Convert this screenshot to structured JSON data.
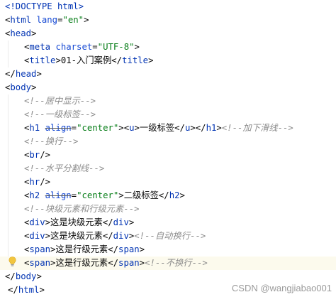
{
  "lines": [
    {
      "indent": 0,
      "tokens": [
        [
          "doctype",
          "<!DOCTYPE html>"
        ]
      ]
    },
    {
      "indent": 0,
      "tokens": [
        [
          "br",
          "<"
        ],
        [
          "tag",
          "html"
        ],
        [
          "txt",
          " "
        ],
        [
          "attr",
          "lang"
        ],
        [
          "br",
          "="
        ],
        [
          "str",
          "\"en\""
        ],
        [
          "br",
          ">"
        ]
      ]
    },
    {
      "indent": 0,
      "tokens": [
        [
          "br",
          "<"
        ],
        [
          "tag",
          "head"
        ],
        [
          "br",
          ">"
        ]
      ]
    },
    {
      "indent": 2,
      "tokens": [
        [
          "br",
          "<"
        ],
        [
          "tag",
          "meta"
        ],
        [
          "txt",
          " "
        ],
        [
          "attr",
          "charset"
        ],
        [
          "br",
          "="
        ],
        [
          "str",
          "\"UTF-8\""
        ],
        [
          "br",
          ">"
        ]
      ]
    },
    {
      "indent": 2,
      "tokens": [
        [
          "br",
          "<"
        ],
        [
          "tag",
          "title"
        ],
        [
          "br",
          ">"
        ],
        [
          "txt",
          "01-入门案例"
        ],
        [
          "br",
          "</"
        ],
        [
          "tag",
          "title"
        ],
        [
          "br",
          ">"
        ]
      ]
    },
    {
      "indent": 0,
      "tokens": [
        [
          "br",
          "</"
        ],
        [
          "tag",
          "head"
        ],
        [
          "br",
          ">"
        ]
      ]
    },
    {
      "indent": 0,
      "tokens": [
        [
          "br",
          "<"
        ],
        [
          "tag",
          "body"
        ],
        [
          "br",
          ">"
        ]
      ]
    },
    {
      "indent": 2,
      "tokens": [
        [
          "cmt",
          "<!--居中显示-->"
        ]
      ]
    },
    {
      "indent": 2,
      "tokens": [
        [
          "cmt",
          "<!--一级标签-->"
        ]
      ]
    },
    {
      "indent": 2,
      "tokens": [
        [
          "br",
          "<"
        ],
        [
          "tag",
          "h1"
        ],
        [
          "txt",
          " "
        ],
        [
          "dep",
          "align"
        ],
        [
          "br",
          "="
        ],
        [
          "str",
          "\"center\""
        ],
        [
          "br",
          ">"
        ],
        [
          "br",
          "<"
        ],
        [
          "tag",
          "u"
        ],
        [
          "br",
          ">"
        ],
        [
          "txt",
          "一级标签"
        ],
        [
          "br",
          "</"
        ],
        [
          "tag",
          "u"
        ],
        [
          "br",
          "></"
        ],
        [
          "tag",
          "h1"
        ],
        [
          "br",
          ">"
        ],
        [
          "cmt",
          "<!--加下滑线-->"
        ]
      ]
    },
    {
      "indent": 2,
      "tokens": [
        [
          "cmt",
          "<!--换行-->"
        ]
      ]
    },
    {
      "indent": 2,
      "tokens": [
        [
          "br",
          "<"
        ],
        [
          "tag",
          "br"
        ],
        [
          "br",
          "/>"
        ]
      ]
    },
    {
      "indent": 2,
      "tokens": [
        [
          "cmt",
          "<!--水平分割线-->"
        ]
      ]
    },
    {
      "indent": 2,
      "tokens": [
        [
          "br",
          "<"
        ],
        [
          "tag",
          "hr"
        ],
        [
          "br",
          "/>"
        ]
      ]
    },
    {
      "indent": 2,
      "tokens": [
        [
          "br",
          "<"
        ],
        [
          "tag",
          "h2"
        ],
        [
          "txt",
          " "
        ],
        [
          "dep",
          "align"
        ],
        [
          "br",
          "="
        ],
        [
          "str",
          "\"center\""
        ],
        [
          "br",
          ">"
        ],
        [
          "txt",
          "二级标签"
        ],
        [
          "br",
          "</"
        ],
        [
          "tag",
          "h2"
        ],
        [
          "br",
          ">"
        ]
      ]
    },
    {
      "indent": 2,
      "tokens": [
        [
          "cmt",
          "<!--块级元素和行级元素-->"
        ]
      ]
    },
    {
      "indent": 2,
      "tokens": [
        [
          "br",
          "<"
        ],
        [
          "tag",
          "div"
        ],
        [
          "br",
          ">"
        ],
        [
          "txt",
          "这是块级元素"
        ],
        [
          "br",
          "</"
        ],
        [
          "tag",
          "div"
        ],
        [
          "br",
          ">"
        ]
      ]
    },
    {
      "indent": 2,
      "tokens": [
        [
          "br",
          "<"
        ],
        [
          "tag",
          "div"
        ],
        [
          "br",
          ">"
        ],
        [
          "txt",
          "这是块级元素"
        ],
        [
          "br",
          "</"
        ],
        [
          "tag",
          "div"
        ],
        [
          "br",
          ">"
        ],
        [
          "cmt",
          "<!--自动换行-->"
        ]
      ]
    },
    {
      "indent": 2,
      "tokens": [
        [
          "br",
          "<"
        ],
        [
          "tag",
          "span"
        ],
        [
          "br",
          ">"
        ],
        [
          "txt",
          "这是行级元素"
        ],
        [
          "br",
          "</"
        ],
        [
          "tag",
          "span"
        ],
        [
          "br",
          ">"
        ]
      ]
    },
    {
      "indent": 2,
      "caret": true,
      "tokens": [
        [
          "br",
          "<"
        ],
        [
          "tag",
          "span"
        ],
        [
          "br",
          ">"
        ],
        [
          "txt",
          "这是行级元素"
        ],
        [
          "br",
          "</"
        ],
        [
          "tag",
          "span"
        ],
        [
          "br",
          ">"
        ],
        [
          "cmt",
          "<!--不换行-->"
        ]
      ]
    },
    {
      "indent": 0,
      "tokens": [
        [
          "br",
          "</"
        ],
        [
          "tag",
          "body"
        ],
        [
          "br",
          ">"
        ]
      ]
    },
    {
      "indent": 1,
      "tokens": [
        [
          "br",
          "</"
        ],
        [
          "tag",
          "html"
        ],
        [
          "br",
          ">"
        ]
      ]
    }
  ],
  "gutter_icon": "lightbulb-icon",
  "watermark": "CSDN @wangjiabao001"
}
